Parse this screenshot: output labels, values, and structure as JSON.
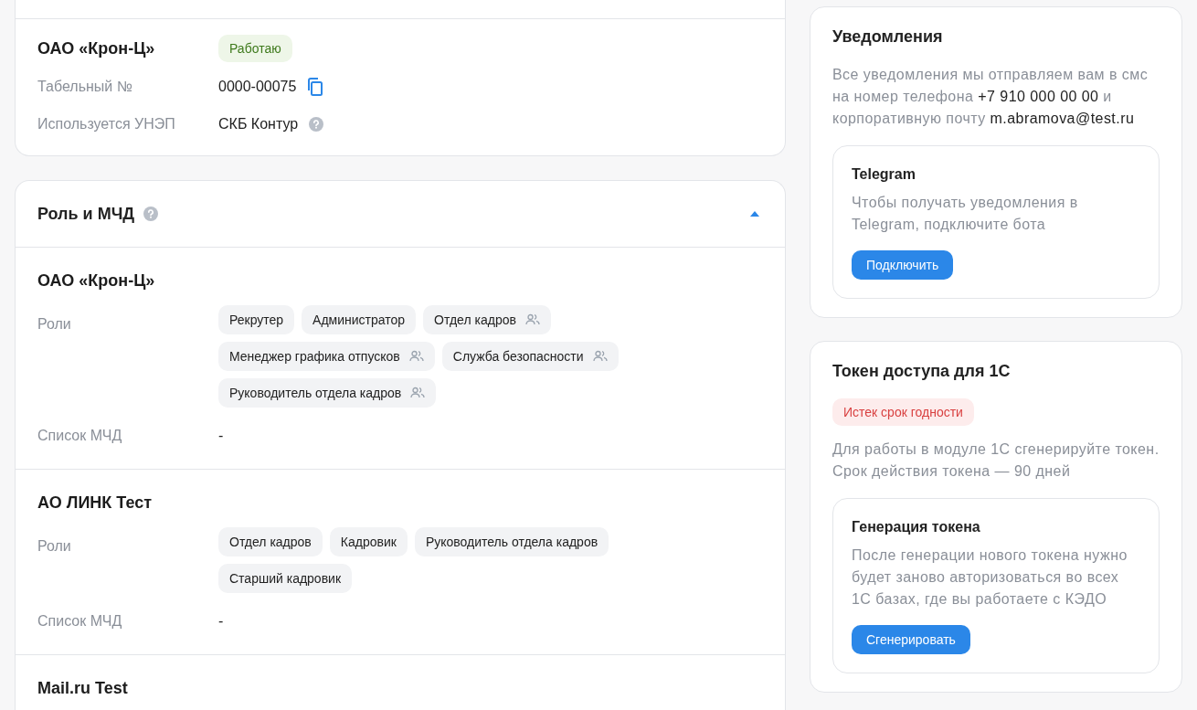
{
  "employment": {
    "company": "ОАО «Крон-Ц»",
    "status": {
      "label": "Работаю",
      "kind": "success"
    },
    "fields": [
      {
        "label": "Табельный №",
        "value": "0000-00075",
        "kind": "copy"
      },
      {
        "label": "Используется УНЭП",
        "value": "СКБ Контур",
        "kind": "help"
      }
    ]
  },
  "roles_section": {
    "title": "Роль и МЧД",
    "expanded": true,
    "companies": [
      {
        "name": "ОАО «Крон-Ц»",
        "roles_label": "Роли",
        "roles": [
          {
            "label": "Рекрутер",
            "group": false
          },
          {
            "label": "Администратор",
            "group": false
          },
          {
            "label": "Отдел кадров",
            "group": true
          },
          {
            "label": "Менеджер графика отпусков",
            "group": true
          },
          {
            "label": "Служба безопасности",
            "group": true
          },
          {
            "label": "Руководитель отдела кадров",
            "group": true
          }
        ],
        "mchd_label": "Список МЧД",
        "mchd_value": "-"
      },
      {
        "name": "АО ЛИНК Тест",
        "roles_label": "Роли",
        "roles": [
          {
            "label": "Отдел кадров",
            "group": false
          },
          {
            "label": "Кадровик",
            "group": false
          },
          {
            "label": "Руководитель отдела кадров",
            "group": false
          },
          {
            "label": "Старший кадровик",
            "group": false
          }
        ],
        "mchd_label": "Список МЧД",
        "mchd_value": "-"
      },
      {
        "name": "Mail.ru Test"
      }
    ]
  },
  "notifications": {
    "title": "Уведомления",
    "text": [
      {
        "text": "Все уведомления мы отправляем вам в смс на номер телефона ",
        "emphasis": false
      },
      {
        "text": "+7 910 000 00 00",
        "emphasis": true
      },
      {
        "text": " и корпоративную почту ",
        "emphasis": false
      },
      {
        "text": "m.abramova@test.ru",
        "emphasis": true
      }
    ],
    "telegram": {
      "title": "Telegram",
      "text": "Чтобы получать уведомления в Telegram, подключите бота",
      "button": "Подключить"
    }
  },
  "token": {
    "title": "Токен доступа для 1С",
    "status": {
      "label": "Истек срок годности",
      "kind": "error"
    },
    "text": "Для работы в модуле 1С сгенерируйте токен. Срок действия токена — 90 дней",
    "generation": {
      "title": "Генерация токена",
      "text": "После генерации нового токена нужно будет заново авторизоваться во всех 1С базах, где вы работаете с КЭДО",
      "button": "Сгенерировать"
    }
  }
}
